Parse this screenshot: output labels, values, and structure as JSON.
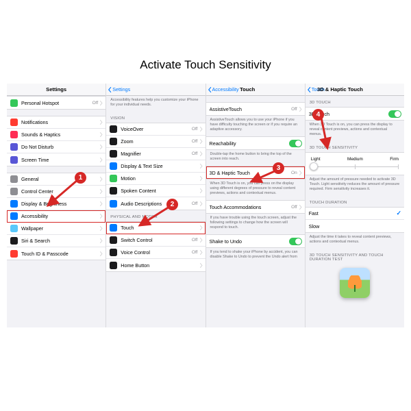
{
  "title": "Activate Touch Sensitivity",
  "annotations": {
    "b1": "1",
    "b2": "2",
    "b3": "3",
    "b4": "4"
  },
  "colors": {
    "accent": "#007aff",
    "highlight": "#d62826",
    "toggle_on": "#34c759"
  },
  "panel1": {
    "header": "Settings",
    "groupA": [
      {
        "icon": "hotspot",
        "color": "#34c759",
        "label": "Personal Hotspot",
        "value": "Off"
      }
    ],
    "groupB": [
      {
        "icon": "bell",
        "color": "#ff3b30",
        "label": "Notifications"
      },
      {
        "icon": "speaker",
        "color": "#ff2d55",
        "label": "Sounds & Haptics"
      },
      {
        "icon": "moon",
        "color": "#5856d6",
        "label": "Do Not Disturb"
      },
      {
        "icon": "hourglass",
        "color": "#5856d6",
        "label": "Screen Time"
      }
    ],
    "groupC": [
      {
        "icon": "gear",
        "color": "#8e8e93",
        "label": "General"
      },
      {
        "icon": "sliders",
        "color": "#8e8e93",
        "label": "Control Center"
      },
      {
        "icon": "sun",
        "color": "#007aff",
        "label": "Display & Brightness"
      },
      {
        "icon": "person",
        "color": "#007aff",
        "label": "Accessibility",
        "highlight": true
      },
      {
        "icon": "flower",
        "color": "#5ac8fa",
        "label": "Wallpaper"
      },
      {
        "icon": "siri",
        "color": "#1b1b1d",
        "label": "Siri & Search"
      },
      {
        "icon": "touchid",
        "color": "#ff3b30",
        "label": "Touch ID & Passcode"
      }
    ]
  },
  "panel2": {
    "back": "Settings",
    "intro": "Accessibility features help you customize your iPhone for your individual needs.",
    "sectionA": "VISION",
    "groupA": [
      {
        "icon": "voiceover",
        "color": "#1b1b1d",
        "label": "VoiceOver",
        "value": "Off"
      },
      {
        "icon": "zoom",
        "color": "#1b1b1d",
        "label": "Zoom",
        "value": "Off"
      },
      {
        "icon": "mag",
        "color": "#1b1b1d",
        "label": "Magnifier",
        "value": "Off"
      },
      {
        "icon": "text",
        "color": "#007aff",
        "label": "Display & Text Size"
      },
      {
        "icon": "motion",
        "color": "#34c759",
        "label": "Motion"
      },
      {
        "icon": "speak",
        "color": "#1b1b1d",
        "label": "Spoken Content"
      },
      {
        "icon": "audio",
        "color": "#007aff",
        "label": "Audio Descriptions",
        "value": "Off"
      }
    ],
    "sectionB": "PHYSICAL AND MOTOR",
    "groupB": [
      {
        "icon": "touch",
        "color": "#007aff",
        "label": "Touch",
        "highlight": true
      },
      {
        "icon": "switch",
        "color": "#1b1b1d",
        "label": "Switch Control",
        "value": "Off"
      },
      {
        "icon": "mic",
        "color": "#1b1b1d",
        "label": "Voice Control",
        "value": "Off"
      },
      {
        "icon": "home",
        "color": "#1b1b1d",
        "label": "Home Button"
      }
    ]
  },
  "panel3": {
    "back": "Accessibility",
    "title": "Touch",
    "groupA": [
      {
        "label": "AssistiveTouch",
        "value": "Off"
      }
    ],
    "footA": "AssistiveTouch allows you to use your iPhone if you have difficulty touching the screen or if you require an adaptive accessory.",
    "groupB": [
      {
        "label": "Reachability",
        "toggle": "on"
      }
    ],
    "footB": "Double-tap the home button to bring the top of the screen into reach.",
    "groupC": [
      {
        "label": "3D & Haptic Touch",
        "value": "On",
        "highlight": true
      }
    ],
    "footC": "When 3D Touch is on, you can press on the display using different degrees of pressure to reveal content previews, actions and contextual menus.",
    "groupD": [
      {
        "label": "Touch Accommodations",
        "value": "Off"
      }
    ],
    "footD": "If you have trouble using the touch screen, adjust the following settings to change how the screen will respond to touch.",
    "groupE": [
      {
        "label": "Shake to Undo",
        "toggle": "on"
      }
    ],
    "footE": "If you tend to shake your iPhone by accident, you can disable Shake to Undo to prevent the Undo alert from"
  },
  "panel4": {
    "back": "Touch",
    "title": "3D & Haptic Touch",
    "sectionA": "3D TOUCH",
    "rowA": {
      "label": "3D Touch",
      "toggle": "on"
    },
    "footA": "When 3D Touch is on, you can press the display to reveal content previews, actions and contextual menus.",
    "sectionB": "3D TOUCH SENSITIVITY",
    "slider": {
      "options": [
        "Light",
        "Medium",
        "Firm"
      ],
      "value_index": 0
    },
    "footB": "Adjust the amount of pressure needed to activate 3D Touch. Light sensitivity reduces the amount of pressure required. Firm sensitivity increases it.",
    "sectionC": "TOUCH DURATION",
    "groupC": [
      {
        "label": "Fast",
        "checked": true
      },
      {
        "label": "Slow",
        "checked": false
      }
    ],
    "footC": "Adjust the time it takes to reveal content previews, actions and contextual menus.",
    "sectionD": "3D TOUCH SENSITIVITY AND TOUCH DURATION TEST"
  }
}
